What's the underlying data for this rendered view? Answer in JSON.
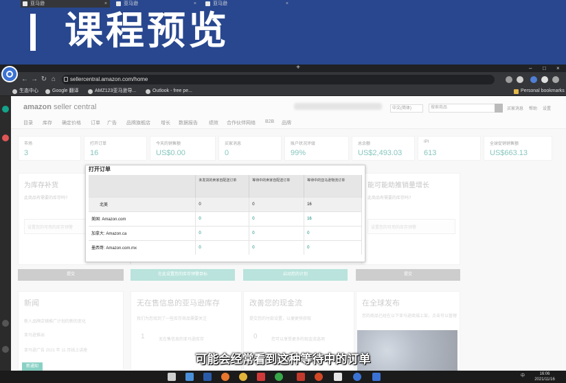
{
  "banner": {
    "title": "课程预览"
  },
  "browser": {
    "tabs": [
      {
        "label": "亚马逊",
        "close": "×"
      },
      {
        "label": "亚马逊",
        "close": "×"
      },
      {
        "label": "亚马逊",
        "close": "×"
      }
    ],
    "new_tab": "+",
    "window_controls": {
      "minimize": "–",
      "maximize": "□",
      "close": "×"
    },
    "nav": {
      "back": "←",
      "forward": "→",
      "reload": "↻",
      "home": "⌂"
    },
    "url": "sellercentral.amazon.com/home",
    "bookmarks": [
      {
        "label": "生态中心"
      },
      {
        "label": "Google 翻译"
      },
      {
        "label": "AMZ123亚马逊导..."
      },
      {
        "label": "Outlook - free pe..."
      }
    ],
    "personal_bookmarks": "Personal bookmarks"
  },
  "amazon": {
    "logo_main": "amazon",
    "logo_sub": "seller central",
    "language": "中文(简体)",
    "search_placeholder": "搜索商品",
    "header_links": [
      "买家消息",
      "帮助",
      "设置"
    ],
    "menu": [
      "目录",
      "库存",
      "确定价格",
      "订单",
      "广告",
      "品牌旗舰店",
      "增长",
      "数据报告",
      "绩效",
      "合作伙伴网络",
      "B2B",
      "品牌"
    ],
    "metrics": [
      {
        "label": "市场",
        "value": "3"
      },
      {
        "label": "打开订单",
        "value": "16"
      },
      {
        "label": "今天的销售额",
        "value": "US$0.00"
      },
      {
        "label": "买家消息",
        "value": "0"
      },
      {
        "label": "账户状况评级",
        "value": "99%"
      },
      {
        "label": "总余额",
        "value": "US$2,493.03"
      },
      {
        "label": "IPI",
        "value": "613"
      },
      {
        "label": "全球促销销售额",
        "value": "US$663.13"
      }
    ],
    "cards": {
      "restock": {
        "title": "为库存补货",
        "subtitle": "此商品有需要的库存吗?",
        "input": "设置您的可用的库存预警"
      },
      "growth": {
        "title": "能可能助推销量增长",
        "subtitle": "此商品有需要的库存吗?",
        "input": "设置您的可用的库存预警"
      }
    },
    "buttons": [
      "提交",
      "在此设置您的库存预警目标",
      "启动您的计划",
      "提交"
    ],
    "lower_cards": [
      {
        "title": "新闻",
        "line1": "新人品牌店铺推广计划的新的变化",
        "line2": "亚马逊推出",
        "line3": "亚马逊广告 2021 年 11 月线上讲座"
      },
      {
        "title": "无在售信息的亚马逊库存",
        "line1": "我们为您找到了一些库存商品需要关注",
        "line2": "1",
        "line3": "无在售信息的亚马逊库存"
      },
      {
        "title": "改善您的现金流",
        "line1": "提交您的付款设置，以便更快获取",
        "line2": "0",
        "line3": "您可以享受更多的现金流选项"
      },
      {
        "title": "在全球发布",
        "line1": "您的商品已经在以下亚马逊商城上架，点击可以管理",
        "line2": ""
      }
    ],
    "badge": "新通知"
  },
  "popup": {
    "title": "打开订单",
    "headers": [
      "",
      "未发货的卖家自配送订单",
      "等待中的卖家自配送订单",
      "等待中的亚马逊物流订单"
    ],
    "rows": [
      {
        "market": "北美",
        "a": "0",
        "b": "0",
        "c": "16"
      },
      {
        "market": "美国: Amazon.com",
        "a": "0",
        "b": "0",
        "c": "16"
      },
      {
        "market": "加拿大: Amazon.ca",
        "a": "0",
        "b": "0",
        "c": "0"
      },
      {
        "market": "墨西哥: Amazon.com.mx",
        "a": "0",
        "b": "0",
        "c": "0"
      }
    ]
  },
  "subtitle": "可能会经常看到这种等待中的订单",
  "taskbar": {
    "input_method": "中",
    "time": "16:06",
    "date": "2021/11/16"
  },
  "colors": {
    "banner": "#28478f",
    "teal_value": "#0a8a7a",
    "button_gray": "#9a9a9a",
    "button_teal": "#73c7b8"
  }
}
